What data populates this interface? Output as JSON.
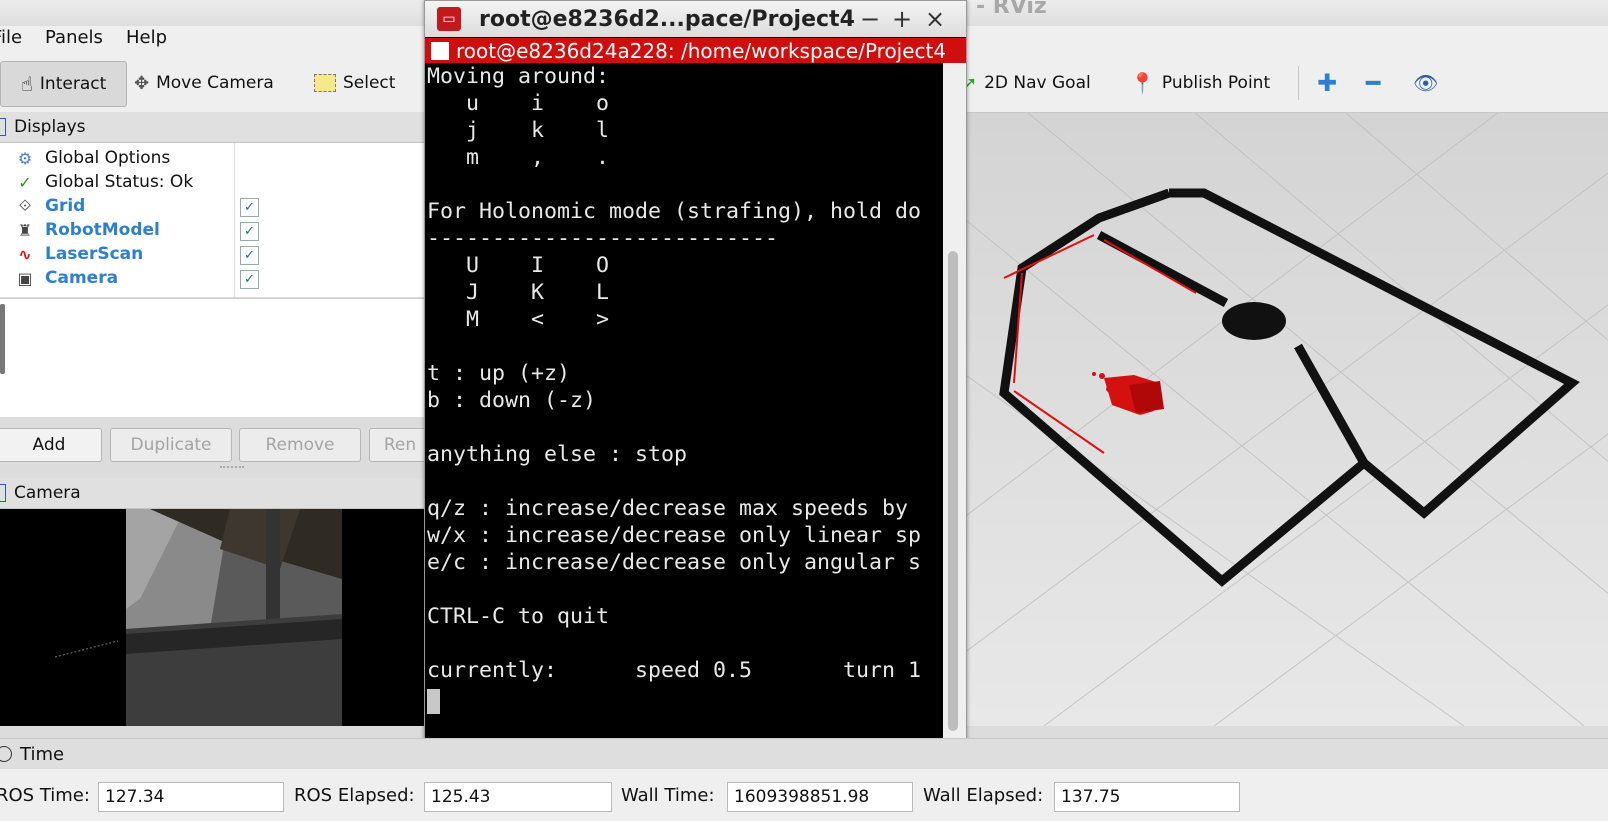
{
  "window": {
    "title": "- RViz"
  },
  "menu": [
    "File",
    "Panels",
    "Help"
  ],
  "toolbar": {
    "interact": "Interact",
    "move_camera": "Move Camera",
    "select": "Select",
    "nav_goal": "2D Nav Goal",
    "publish_point": "Publish Point",
    "icons": [
      "plus-icon",
      "minus-icon",
      "eye-icon"
    ]
  },
  "displays": {
    "header": "Displays",
    "items": [
      {
        "label": "Global Options",
        "icon": "gear-icon",
        "highlight": false
      },
      {
        "label": "Global Status: Ok",
        "icon": "checkmark-icon",
        "highlight": false
      },
      {
        "label": "Grid",
        "icon": "grid-icon",
        "highlight": true,
        "checked": true
      },
      {
        "label": "RobotModel",
        "icon": "robot-icon",
        "highlight": true,
        "checked": true
      },
      {
        "label": "LaserScan",
        "icon": "laser-icon",
        "highlight": true,
        "checked": true
      },
      {
        "label": "Camera",
        "icon": "camera-icon",
        "highlight": true,
        "checked": true
      }
    ],
    "buttons": {
      "add": "Add",
      "duplicate": "Duplicate",
      "remove": "Remove",
      "rename": "Ren"
    }
  },
  "camera_panel": {
    "header": "Camera"
  },
  "terminal": {
    "title": "root@e8236d2...pace/Project4",
    "tab_title": "root@e8236d24a228: /home/workspace/Project4",
    "lines": [
      "Moving around:",
      "   u    i    o",
      "   j    k    l",
      "   m    ,    .",
      "",
      "For Holonomic mode (strafing), hold do",
      "---------------------------",
      "   U    I    O",
      "   J    K    L",
      "   M    <    >",
      "",
      "t : up (+z)",
      "b : down (-z)",
      "",
      "anything else : stop",
      "",
      "q/z : increase/decrease max speeds by",
      "w/x : increase/decrease only linear sp",
      "e/c : increase/decrease only angular s",
      "",
      "CTRL-C to quit",
      "",
      "currently:      speed 0.5       turn 1"
    ]
  },
  "time": {
    "header": "Time",
    "ros_time_label": "ROS Time:",
    "ros_time": "127.34",
    "ros_elapsed_label": "ROS Elapsed:",
    "ros_elapsed": "125.43",
    "wall_time_label": "Wall Time:",
    "wall_time": "1609398851.98",
    "wall_elapsed_label": "Wall Elapsed:",
    "wall_elapsed": "137.75"
  },
  "colors": {
    "laser": "#e01010",
    "terminal_tab": "#d10e0e",
    "link": "#2f7fd1"
  }
}
